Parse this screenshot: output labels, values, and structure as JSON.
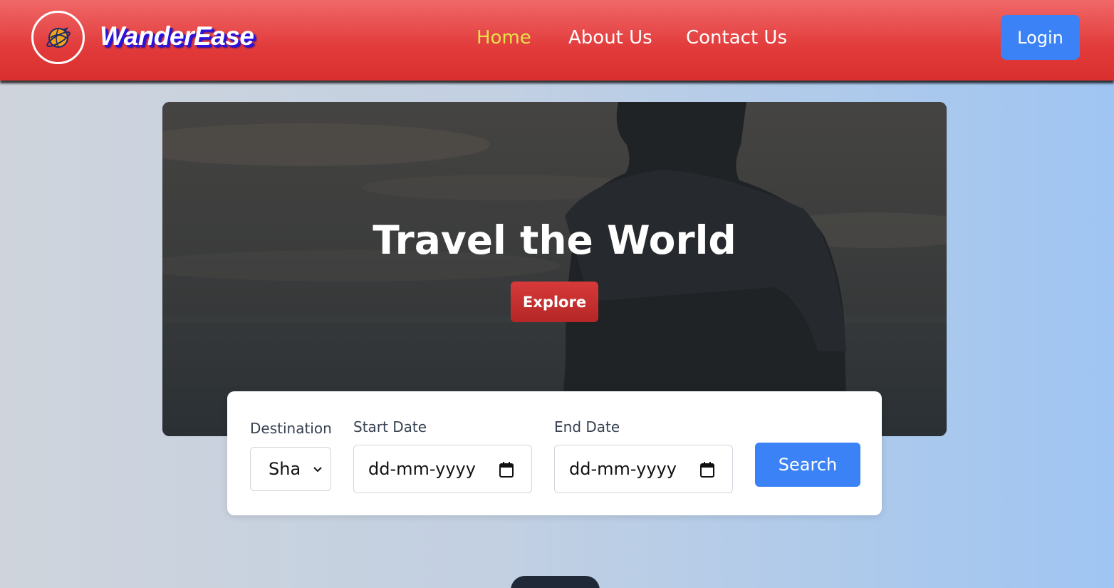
{
  "brand": {
    "name": "WanderEase",
    "logo_icon": "globe-plane-icon"
  },
  "nav": {
    "items": [
      {
        "label": "Home",
        "active": true
      },
      {
        "label": "About Us",
        "active": false
      },
      {
        "label": "Contact Us",
        "active": false
      }
    ],
    "login_label": "Login"
  },
  "hero": {
    "title": "Travel the World",
    "explore_label": "Explore"
  },
  "search": {
    "destination_label": "Destination",
    "destination_value": "Sha",
    "start_label": "Start Date",
    "start_placeholder": "dd-mm-yyyy",
    "end_label": "End Date",
    "end_placeholder": "dd-mm-yyyy",
    "search_label": "Search"
  },
  "colors": {
    "navbar": "#e23a3a",
    "active_nav": "#e6e04a",
    "primary_button": "#3b82f6",
    "explore_button": "#c62f2f"
  }
}
